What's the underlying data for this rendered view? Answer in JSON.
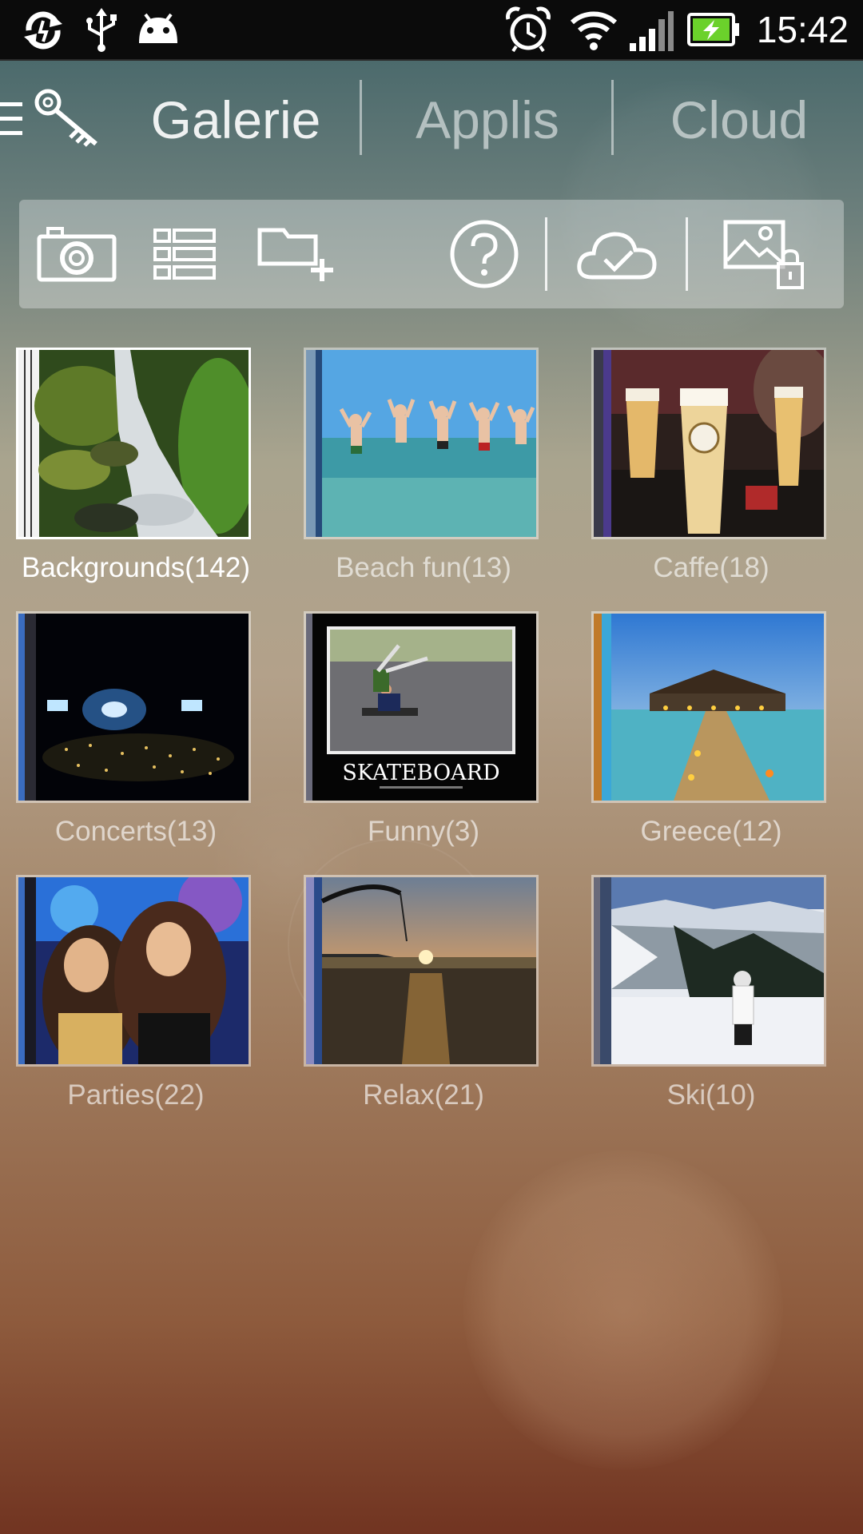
{
  "status_bar": {
    "time": "15:42",
    "icons": [
      "sync-icon",
      "usb-icon",
      "android-debug-icon",
      "alarm-icon",
      "wifi-icon",
      "signal-icon",
      "battery-charging-icon"
    ]
  },
  "nav": {
    "menu_icon": "menu-icon",
    "logo_icon": "key-icon",
    "tabs": [
      {
        "label": "Galerie",
        "active": true
      },
      {
        "label": "Applis",
        "active": false
      },
      {
        "label": "Cloud",
        "active": false
      }
    ]
  },
  "toolbar": {
    "buttons": [
      "camera-icon",
      "list-view-icon",
      "new-folder-icon",
      "help-icon",
      "cloud-sync-icon",
      "locked-image-icon"
    ]
  },
  "albums": [
    {
      "label": "Backgrounds(142)",
      "selected": true
    },
    {
      "label": "Beach fun(13)",
      "selected": false
    },
    {
      "label": "Caffe(18)",
      "selected": false
    },
    {
      "label": "Concerts(13)",
      "selected": false
    },
    {
      "label": "Funny(3)",
      "selected": false,
      "caption": "SKATEBOARD"
    },
    {
      "label": "Greece(12)",
      "selected": false
    },
    {
      "label": "Parties(22)",
      "selected": false
    },
    {
      "label": "Relax(21)",
      "selected": false
    },
    {
      "label": "Ski(10)",
      "selected": false
    }
  ],
  "colors": {
    "status_bar": "#0b0b0b",
    "battery": "#6bd12b",
    "toolbar_bg": "rgba(255,255,255,0.32)"
  }
}
